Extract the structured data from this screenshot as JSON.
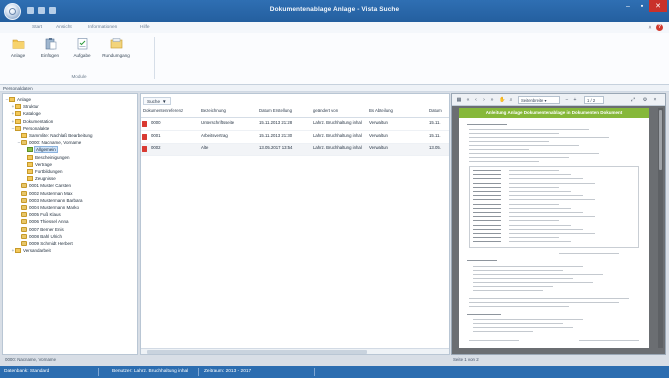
{
  "window": {
    "title": "Dokumentenablage Anlage - Vista Suche",
    "controls": {
      "minimize": "–",
      "maximize": "▪",
      "close": "✕"
    }
  },
  "ribbon": {
    "tabs": [
      "Start",
      "Ansicht",
      "Informationen",
      "Hilfe"
    ],
    "right": {
      "min": "˄",
      "help": "?"
    },
    "buttons": [
      {
        "label": "Anlage",
        "icon": "folder-icon"
      },
      {
        "label": "Einfügen",
        "icon": "paste-icon"
      },
      {
        "label": "Aufgabe",
        "icon": "task-icon"
      },
      {
        "label": "Rundumgang",
        "icon": "tour-icon"
      }
    ],
    "group_label": "Module"
  },
  "panel_header": "Personaldaten",
  "tree": {
    "items": [
      {
        "label": "Anlage",
        "toggle": "–",
        "indent": 0,
        "icon": "folder"
      },
      {
        "label": "Struktur",
        "toggle": "+",
        "indent": 1,
        "icon": "folder"
      },
      {
        "label": "Kataloge",
        "toggle": "+",
        "indent": 1,
        "icon": "folder"
      },
      {
        "label": "Dokumentation",
        "toggle": "+",
        "indent": 1,
        "icon": "folder"
      },
      {
        "label": "Personalakte",
        "toggle": "–",
        "indent": 1,
        "icon": "folder"
      },
      {
        "label": "Sammlite: Nachlaß Bearbeitung",
        "toggle": "",
        "indent": 2,
        "icon": "folder"
      },
      {
        "label": "0000: Nacname, Vorname",
        "toggle": "–",
        "indent": 2,
        "icon": "person"
      },
      {
        "label": "Allgemein",
        "toggle": "",
        "indent": 3,
        "icon": "folder",
        "selected": true
      },
      {
        "label": "Bescheinigungen",
        "toggle": "",
        "indent": 3,
        "icon": "folder"
      },
      {
        "label": "Vertrage",
        "toggle": "",
        "indent": 3,
        "icon": "folder"
      },
      {
        "label": "Fortbildungen",
        "toggle": "",
        "indent": 3,
        "icon": "folder"
      },
      {
        "label": "Zeugnisse",
        "toggle": "",
        "indent": 3,
        "icon": "folder"
      },
      {
        "label": "0001 Muster Carsten",
        "toggle": "",
        "indent": 2,
        "icon": "person"
      },
      {
        "label": "0002 Musterman Max",
        "toggle": "",
        "indent": 2,
        "icon": "person"
      },
      {
        "label": "0003 Mustermann Barbara",
        "toggle": "",
        "indent": 2,
        "icon": "person"
      },
      {
        "label": "0004 Mustermann Marko",
        "toggle": "",
        "indent": 2,
        "icon": "person"
      },
      {
        "label": "0005 Fuß Klaus",
        "toggle": "",
        "indent": 2,
        "icon": "person"
      },
      {
        "label": "0006 Thiessel Anna",
        "toggle": "",
        "indent": 2,
        "icon": "person"
      },
      {
        "label": "0007 Berner Enis",
        "toggle": "",
        "indent": 2,
        "icon": "person"
      },
      {
        "label": "0008 Bahl Ulrich",
        "toggle": "",
        "indent": 2,
        "icon": "person"
      },
      {
        "label": "0009 Schmidt Herbert",
        "toggle": "",
        "indent": 2,
        "icon": "person"
      },
      {
        "label": "Versandarbeit",
        "toggle": "+",
        "indent": 1,
        "icon": "folder"
      }
    ],
    "bottom_status": "0000: Nacname, Vorname"
  },
  "list": {
    "search_label": "Suche",
    "search_arrow": "▼",
    "columns": [
      "Dokumentenreferenz",
      "Bezeichnung",
      "Datum Erstellung",
      "geändert von",
      "Bs Abteilung",
      "Datum"
    ],
    "rows": [
      {
        "ref": "0000",
        "bez": "Unterschriftsseite",
        "date": "15.11.2013 21:28",
        "by": "Lahrz. Bruchhaltung inhal",
        "dept": "Verwaltun",
        "extra": "15.11."
      },
      {
        "ref": "0001",
        "bez": "Arbeitsvertrag",
        "date": "15.11.2013 21:30",
        "by": "Lahrz. Bruchhaltung inhal",
        "dept": "Verwaltun",
        "extra": "15.11."
      },
      {
        "ref": "0002",
        "bez": "Alte",
        "date": "13.05.2017 13:54",
        "by": "Lahrz. Bruchhaltung inhal",
        "dept": "Verwaltun",
        "extra": "13.05."
      }
    ]
  },
  "preview": {
    "toolbar": {
      "zoom_field": "Seitenbreite ▾",
      "page_field": "1 / 2"
    },
    "banner": "Anleitung Anlage Dokumentenablage in Dokumenten Dokument",
    "status": "Seite 1 von 2"
  },
  "statusbar": {
    "items": [
      "Datenbank: Standard",
      "Benutzer: Lahrz. Bruchhaltung inhal",
      "Zeitraum: 2013 - 2017"
    ]
  },
  "colors": {
    "titlebar": "#2f6fb3",
    "statusbar": "#2c6db0",
    "preview_banner": "#86b83a",
    "close_button": "#c9312a"
  }
}
